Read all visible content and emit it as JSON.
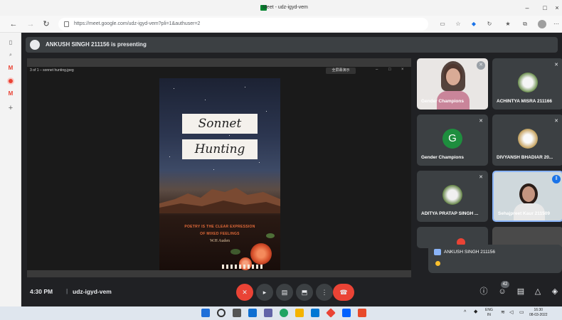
{
  "window": {
    "title": "Meet - udz-igyd-vem",
    "controls": {
      "minimize": "–",
      "maximize": "□",
      "close": "×"
    }
  },
  "browser": {
    "url": "https://meet.google.com/udz-igyd-vem?pli=1&authuser=2",
    "nav_icons": [
      "back-icon",
      "forward-icon",
      "reload-icon"
    ],
    "toolbar_icons": [
      "screen-icon",
      "star-icon",
      "extension-icon",
      "refresh-icon",
      "favorites-icon",
      "collections-icon",
      "profile-icon",
      "more-icon"
    ],
    "sidebar_icons": [
      "tabs-icon",
      "search-icon",
      "gmail-icon",
      "record-icon",
      "gmail-icon",
      "add-icon"
    ]
  },
  "meet": {
    "presenting_banner": "ANKUSH SINGH 211156 is presenting",
    "shared_window": {
      "file_name": "3 of 1 – sonnet hunting.jpeg",
      "toolbar_label": "全屏幕演示"
    },
    "poster": {
      "title_line1": "Sonnet",
      "title_line2": "Hunting",
      "quote_line1": "POETRY IS THE CLEAR EXPRESSION",
      "quote_line2": "OF MIXED FEELINGS",
      "author": "W.H Auden"
    },
    "participants": [
      {
        "name": "Gender Champions",
        "type": "video-girl",
        "muted": true
      },
      {
        "name": "ACHINTYA MISRA 211166",
        "type": "avatar-photo",
        "muted": true
      },
      {
        "name": "Gender Champions",
        "type": "letter",
        "letter": "G",
        "muted": true
      },
      {
        "name": "DIVYANSH BHADIAR 20...",
        "type": "avatar-photo",
        "muted": true
      },
      {
        "name": "ADITYA PRATAP SINGH ...",
        "type": "avatar-photo",
        "muted": true
      },
      {
        "name": "Sehajpreet Kaur 211509",
        "type": "video-speaking",
        "muted": false
      }
    ],
    "chat_toast": {
      "sender": "ANKUSH SINGH 211156"
    },
    "controls": {
      "time": "4:30 PM",
      "meeting_code": "udz-igyd-vem",
      "participant_count": "42"
    }
  },
  "taskbar": {
    "lang_line1": "ENG",
    "lang_line2": "IN",
    "time": "16:30",
    "date": "08-03-2022"
  },
  "colors": {
    "meet_background": "#202124",
    "tile_background": "#3c4043",
    "end_call": "#ea4335",
    "active_speaker_border": "#8ab4f8"
  }
}
